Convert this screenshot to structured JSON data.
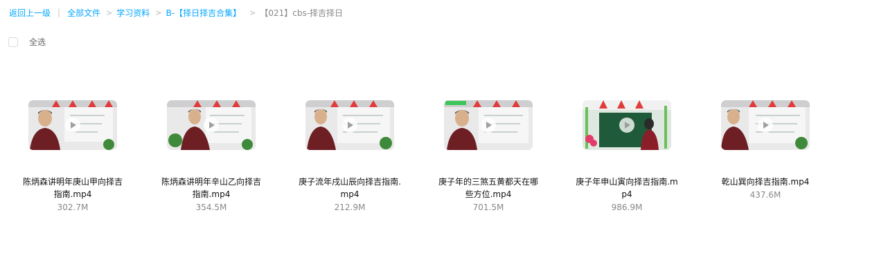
{
  "breadcrumb": {
    "back": "返回上一级",
    "all_files": "全部文件",
    "level1": "学习资料",
    "level2": "B-【择日择吉合集】",
    "current": "【021】cbs-择吉择日",
    "separator": ">",
    "pipe": "|"
  },
  "toolbar": {
    "select_all": "全选"
  },
  "files": [
    {
      "name": "陈炳森讲明年庚山甲向择吉指南.mp4",
      "size": "302.7M",
      "type_icon": "video-play-icon"
    },
    {
      "name": "陈炳森讲明年辛山乙向择吉指南.mp4",
      "size": "354.5M",
      "type_icon": "video-play-icon"
    },
    {
      "name": "庚子流年戌山辰向择吉指南.mp4",
      "size": "212.9M",
      "type_icon": "video-play-icon"
    },
    {
      "name": "庚子年的三煞五黄都天在哪些方位.mp4",
      "size": "701.5M",
      "type_icon": "video-play-icon"
    },
    {
      "name": "庚子年申山寅向择吉指南.mp4",
      "size": "986.9M",
      "type_icon": "video-play-icon"
    },
    {
      "name": "乾山巽向择吉指南.mp4",
      "size": "437.6M",
      "type_icon": "video-play-icon"
    }
  ],
  "colors": {
    "link": "#06a7ff",
    "muted": "#888888",
    "text": "#111111"
  }
}
